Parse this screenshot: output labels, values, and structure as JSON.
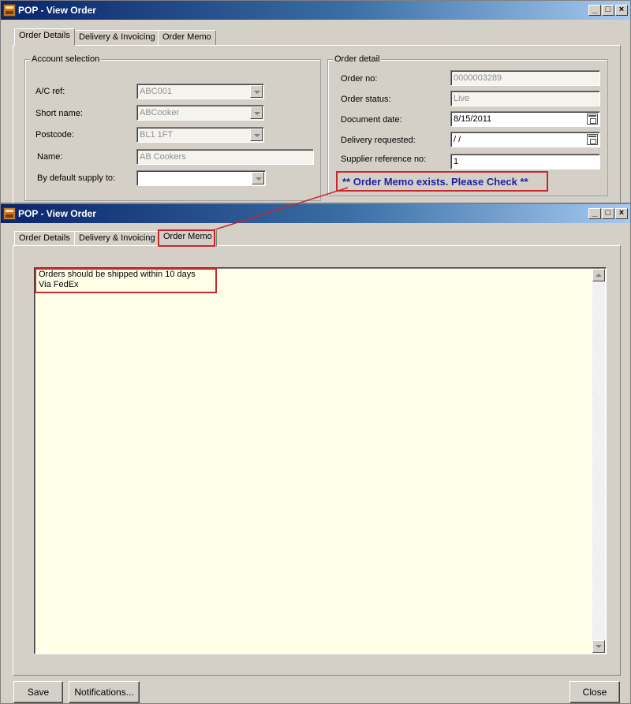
{
  "window_back": {
    "title": "POP - View Order",
    "tabs": [
      "Order Details",
      "Delivery & Invoicing",
      "Order Memo"
    ],
    "account_selection": {
      "legend": "Account selection",
      "ac_ref_label": "A/C ref:",
      "ac_ref_value": "ABC001",
      "short_name_label": "Short name:",
      "short_name_value": "ABCooker",
      "postcode_label": "Postcode:",
      "postcode_value": "BL1 1FT",
      "name_label": "Name:",
      "name_value": "AB Cookers",
      "default_supply_label": "By default supply to:",
      "default_supply_value": ""
    },
    "order_detail": {
      "legend": "Order detail",
      "order_no_label": "Order no:",
      "order_no_value": "0000003289",
      "order_status_label": "Order status:",
      "order_status_value": "Live",
      "document_date_label": "Document date:",
      "document_date_value": "8/15/2011",
      "delivery_requested_label": "Delivery requested:",
      "delivery_requested_value": " / /",
      "supplier_ref_label": "Supplier reference no:",
      "supplier_ref_value": "1"
    },
    "memo_alert": "** Order Memo exists. Please Check **"
  },
  "window_front": {
    "title": "POP - View Order",
    "tabs": [
      "Order Details",
      "Delivery & Invoicing",
      "Order Memo"
    ],
    "active_tab": "Order Memo",
    "memo_lines": [
      "Orders should be shipped within 10 days",
      "Via FedEx"
    ],
    "buttons": {
      "save": "Save",
      "notifications": "Notifications...",
      "close": "Close"
    }
  },
  "annotation_color": "#c8282c",
  "alert_text_color": "#1f1f9f",
  "memo_background": "#ffffe8"
}
